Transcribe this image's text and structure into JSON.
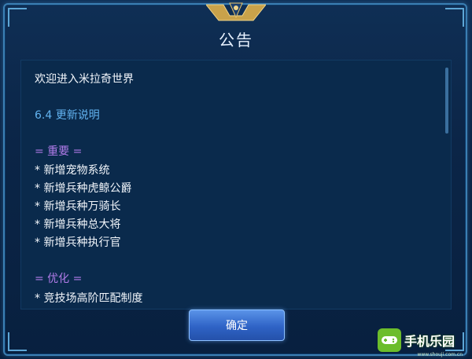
{
  "dialog": {
    "title": "公告",
    "confirm_label": "确定"
  },
  "content": {
    "welcome": "欢迎进入米拉奇世界",
    "version_note": "6.4 更新说明",
    "section_important": "= 重要 =",
    "important_items": [
      "* 新增宠物系统",
      "* 新增兵种虎鲸公爵",
      "* 新增兵种万骑长",
      "* 新增兵种总大将",
      "* 新增兵种执行官"
    ],
    "section_optimize": "= 优化 =",
    "optimize_items": [
      "* 竞技场高阶匹配制度"
    ]
  },
  "watermark": {
    "text": "手机乐园",
    "url": "www.shouji.com.cn"
  },
  "colors": {
    "accent_blue": "#62b3f0",
    "section_purple": "#b07be8",
    "button_blue": "#2f63c6"
  }
}
